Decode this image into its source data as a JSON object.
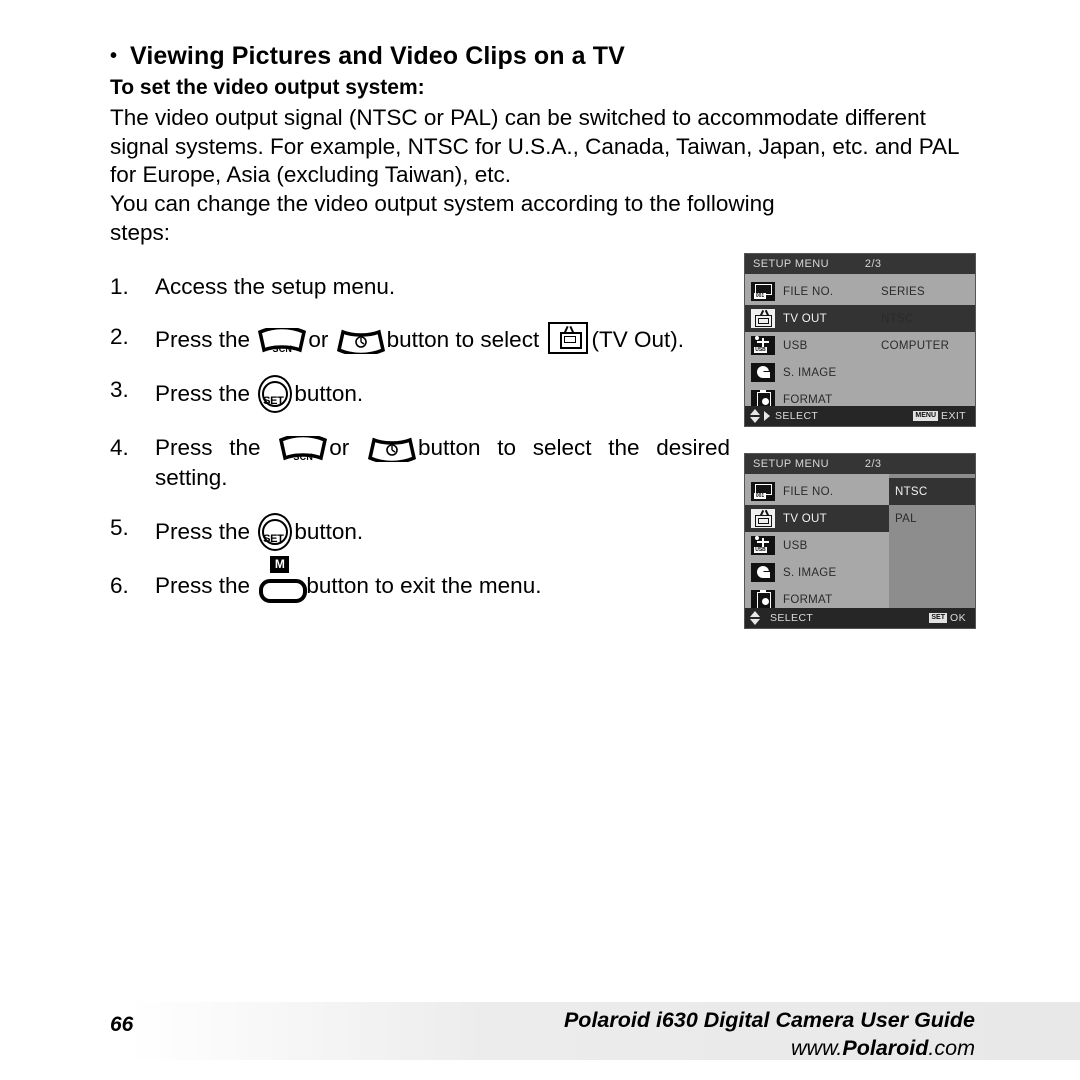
{
  "heading": {
    "bullet": "•",
    "title": "Viewing Pictures and Video Clips on a TV",
    "subtitle": "To set the video output system:"
  },
  "paragraphs": {
    "p1": "The video output signal (NTSC or PAL) can be switched to accommodate different signal systems. For example, NTSC for U.S.A., Canada, Taiwan, Japan, etc. and PAL for Europe, Asia (excluding Taiwan), etc.",
    "p2_main": "You can change the video output system according to the following",
    "p2_last": "steps:"
  },
  "steps": [
    {
      "num": "1.",
      "text": "Access the setup menu."
    },
    {
      "num": "2.",
      "pre": "Press the",
      "mid": "or",
      "post": "button to select",
      "tail": "(TV Out)."
    },
    {
      "num": "3.",
      "pre": "Press the",
      "post": "button."
    },
    {
      "num": "4.",
      "pre": "Press the",
      "mid": "or",
      "post": "button to select the desired setting."
    },
    {
      "num": "5.",
      "pre": "Press the",
      "post": "button."
    },
    {
      "num": "6.",
      "pre": "Press the",
      "post": "button to exit the menu."
    }
  ],
  "buttons": {
    "scn_label": "SCN",
    "set_label": "SET",
    "menu_label": "M"
  },
  "lcd1": {
    "title": "SETUP MENU",
    "page": "2/3",
    "rows": [
      {
        "icon": "file-number-icon",
        "label": "FILE NO.",
        "value": "SERIES",
        "selected": false
      },
      {
        "icon": "tv-out-icon",
        "label": "TV OUT",
        "value": "NTSC",
        "selected": true
      },
      {
        "icon": "usb-icon",
        "label": "USB",
        "value": "COMPUTER",
        "selected": false
      },
      {
        "icon": "startup-image-icon",
        "label": "S. IMAGE",
        "value": "",
        "selected": false
      },
      {
        "icon": "format-icon",
        "label": "FORMAT",
        "value": "",
        "selected": false
      }
    ],
    "footer": {
      "select": "SELECT",
      "action_badge": "MENU",
      "action": "EXIT"
    }
  },
  "lcd2": {
    "title": "SETUP MENU",
    "page": "2/3",
    "rows": [
      {
        "icon": "file-number-icon",
        "label": "FILE NO.",
        "selected": false
      },
      {
        "icon": "tv-out-icon",
        "label": "TV OUT",
        "selected": true
      },
      {
        "icon": "usb-icon",
        "label": "USB",
        "selected": false
      },
      {
        "icon": "startup-image-icon",
        "label": "S. IMAGE",
        "selected": false
      },
      {
        "icon": "format-icon",
        "label": "FORMAT",
        "selected": false
      }
    ],
    "submenu": [
      {
        "label": "NTSC",
        "selected": true
      },
      {
        "label": "PAL",
        "selected": false
      }
    ],
    "footer": {
      "select": "SELECT",
      "action_badge": "SET",
      "action": "OK"
    }
  },
  "footer": {
    "page_number": "66",
    "title": "Polaroid i630 Digital Camera User Guide",
    "url_brand": "Polaroid",
    "url_prefix": "www.",
    "url_suffix": ".com"
  },
  "colors": {
    "lcd_background": "#a8a8a8",
    "lcd_submenu_background": "#8d8d8d",
    "lcd_highlight": "#333333",
    "lcd_titlebar": "#353535",
    "lcd_footerbar": "#262626"
  }
}
